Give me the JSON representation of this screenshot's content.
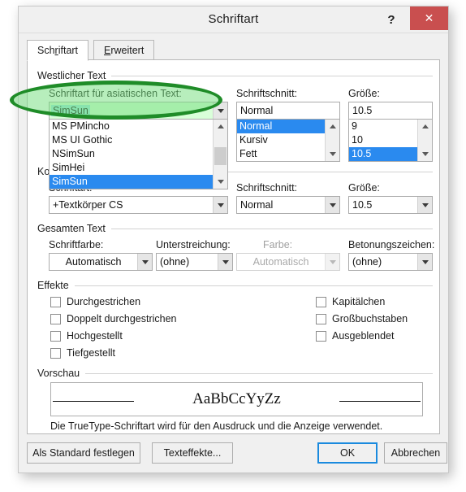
{
  "window": {
    "title": "Schriftart",
    "help_label": "?",
    "close_label": "✕",
    "close_color": "#c94f4f"
  },
  "tabs": [
    {
      "label": "Schriftart",
      "active": true
    },
    {
      "label": "Erweitert",
      "active": false
    }
  ],
  "groups": {
    "western": "Westlicher Text",
    "complex": "Ko",
    "all_text": "Gesamten Text",
    "effects": "Effekte",
    "preview": "Vorschau"
  },
  "asian_font": {
    "label": "Schriftart für asiatischen Text:",
    "value": "SimSun",
    "list": [
      {
        "label": "MS PMincho",
        "selected": false
      },
      {
        "label": "MS UI Gothic",
        "selected": false
      },
      {
        "label": "NSimSun",
        "selected": false
      },
      {
        "label": "SimHei",
        "selected": false
      },
      {
        "label": "SimSun",
        "selected": true
      }
    ]
  },
  "asian_style": {
    "label": "Schriftschnitt:",
    "value": "Normal",
    "list": [
      {
        "label": "Normal",
        "selected": true
      },
      {
        "label": "Kursiv",
        "selected": false
      },
      {
        "label": "Fett",
        "selected": false
      }
    ]
  },
  "asian_size": {
    "label": "Größe:",
    "value": "10.5",
    "list": [
      {
        "label": "9",
        "selected": false
      },
      {
        "label": "10",
        "selected": false
      },
      {
        "label": "10.5",
        "selected": true
      }
    ]
  },
  "complex_font": {
    "label": "Schriftart:",
    "value": "+Textkörper CS"
  },
  "complex_style": {
    "label": "Schriftschnitt:",
    "value": "Normal"
  },
  "complex_size": {
    "label": "Größe:",
    "value": "10.5"
  },
  "all_text_row": {
    "font_color": {
      "label": "Schriftfarbe:",
      "value": "Automatisch",
      "disabled": false
    },
    "underline_style": {
      "label": "Unterstreichung:",
      "value": "(ohne)",
      "disabled": false
    },
    "underline_color": {
      "label": "Farbe:",
      "value": "Automatisch",
      "disabled": true
    },
    "emphasis": {
      "label": "Betonungszeichen:",
      "value": "(ohne)",
      "disabled": false
    }
  },
  "effects": {
    "left": [
      {
        "label": "Durchgestrichen",
        "checked": false
      },
      {
        "label": "Doppelt durchgestrichen",
        "checked": false
      },
      {
        "label": "Hochgestellt",
        "checked": false
      },
      {
        "label": "Tiefgestellt",
        "checked": false
      }
    ],
    "right": [
      {
        "label": "Kapitälchen",
        "checked": false
      },
      {
        "label": "Großbuchstaben",
        "checked": false
      },
      {
        "label": "Ausgeblendet",
        "checked": false
      }
    ]
  },
  "preview": {
    "sample_text": "AaBbCcYyZz",
    "note": "Die TrueType-Schriftart wird für den Ausdruck und die Anzeige verwendet."
  },
  "footer": {
    "set_default": "Als Standard festlegen",
    "text_effects": "Texteffekte...",
    "ok": "OK",
    "cancel": "Abbrechen"
  },
  "annotation": {
    "shape": "ellipse-highlight",
    "border_color": "#1f8c28",
    "fill_color": "#74de7e"
  }
}
